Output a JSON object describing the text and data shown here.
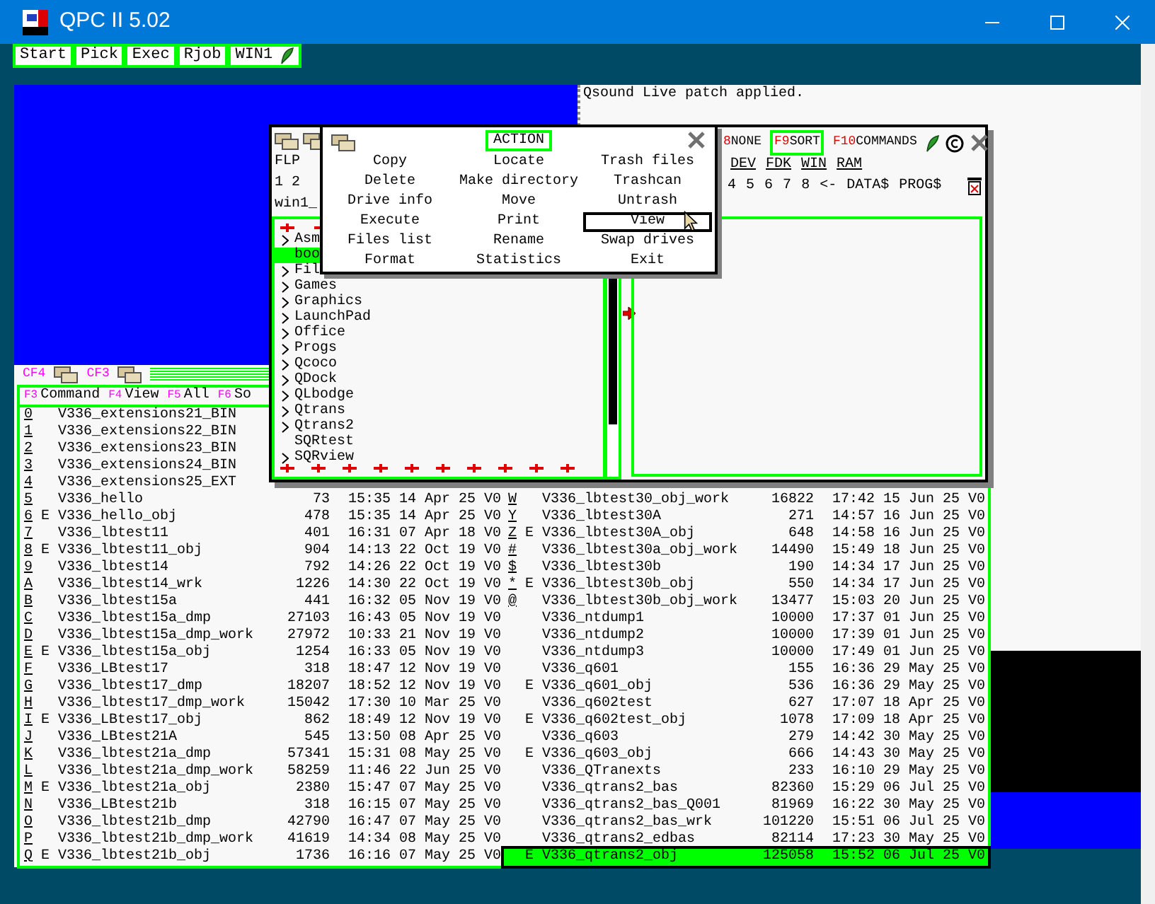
{
  "window": {
    "title": "QPC II 5.02"
  },
  "button_bar": [
    {
      "label": "Start",
      "kind": "command"
    },
    {
      "label": "Pick",
      "kind": "command"
    },
    {
      "label": "Exec",
      "kind": "command"
    },
    {
      "label": "Rjob",
      "kind": "command"
    },
    {
      "label": "WIN1",
      "kind": "window"
    }
  ],
  "sound_window": {
    "message": "Qsound Live patch applied."
  },
  "files_window": {
    "left_header": [
      "FLP",
      "1 2",
      "win1_"
    ],
    "function_keys": [
      {
        "key": "8",
        "label": "NONE",
        "selected": false
      },
      {
        "key": "F9",
        "label": "SORT",
        "selected": true
      },
      {
        "key": "F10",
        "label": "COMMANDS",
        "selected": false
      }
    ],
    "devices": [
      "DEV",
      "FDK",
      "WIN",
      "RAM"
    ],
    "shortcuts": [
      "4",
      "5",
      "6",
      "7",
      "8",
      "<-",
      "DATA$",
      "PROG$"
    ],
    "tree": [
      {
        "label": "Asm",
        "expandable": true,
        "selected": false
      },
      {
        "label": "boo",
        "expandable": false,
        "selected": true
      },
      {
        "label": "Fil",
        "expandable": true,
        "selected": false
      },
      {
        "label": "Games",
        "expandable": true,
        "selected": false
      },
      {
        "label": "Graphics",
        "expandable": true,
        "selected": false
      },
      {
        "label": "LaunchPad",
        "expandable": true,
        "selected": false
      },
      {
        "label": "Office",
        "expandable": true,
        "selected": false
      },
      {
        "label": "Progs",
        "expandable": true,
        "selected": false
      },
      {
        "label": "Qcoco",
        "expandable": true,
        "selected": false
      },
      {
        "label": "QDock",
        "expandable": true,
        "selected": false
      },
      {
        "label": "QLbodge",
        "expandable": true,
        "selected": false
      },
      {
        "label": "Qtrans",
        "expandable": true,
        "selected": false
      },
      {
        "label": "Qtrans2",
        "expandable": true,
        "selected": false
      },
      {
        "label": "SQRtest",
        "expandable": false,
        "selected": false
      },
      {
        "label": "SQRview",
        "expandable": true,
        "selected": false
      }
    ]
  },
  "action_menu": {
    "title": "ACTION",
    "items": [
      {
        "label": "Copy",
        "selected": false
      },
      {
        "label": "Locate",
        "selected": false
      },
      {
        "label": "Trash files",
        "selected": false
      },
      {
        "label": "Delete",
        "selected": false
      },
      {
        "label": "Make directory",
        "selected": false
      },
      {
        "label": "Trashcan",
        "selected": false
      },
      {
        "label": "Drive info",
        "selected": false
      },
      {
        "label": "Move",
        "selected": false
      },
      {
        "label": "Untrash",
        "selected": false
      },
      {
        "label": "Execute",
        "selected": false
      },
      {
        "label": "Print",
        "selected": false
      },
      {
        "label": "View",
        "selected": true
      },
      {
        "label": "Files list",
        "selected": false
      },
      {
        "label": "Rename",
        "selected": false
      },
      {
        "label": "Swap drives",
        "selected": false
      },
      {
        "label": "Format",
        "selected": false
      },
      {
        "label": "Statistics",
        "selected": false
      },
      {
        "label": "Exit",
        "selected": false
      }
    ]
  },
  "file_list": {
    "header_keys": [
      "CF4",
      "CF3"
    ],
    "function_keys": [
      {
        "key": "F3",
        "label": "Command"
      },
      {
        "key": "F4",
        "label": "View"
      },
      {
        "key": "F5",
        "label": "All"
      },
      {
        "key": "F6",
        "label": "So"
      }
    ],
    "left_column": [
      {
        "key": "0",
        "name": "V336_extensions21_BIN",
        "selected": false
      },
      {
        "key": "1",
        "name": "V336_extensions22_BIN",
        "selected": false
      },
      {
        "key": "2",
        "name": "V336_extensions23_BIN",
        "selected": false
      },
      {
        "key": "3",
        "name": "V336_extensions24_BIN",
        "selected": false
      },
      {
        "key": "4",
        "name": "V336_extensions25_EXT",
        "selected": false
      },
      {
        "key": "5",
        "name": "V336_hello",
        "size": "73",
        "time": "15:35",
        "date": "14 Apr 25",
        "version": "V0",
        "selected": false
      },
      {
        "key": "6",
        "flag": "E",
        "name": "V336_hello_obj",
        "size": "478",
        "time": "15:35",
        "date": "14 Apr 25",
        "version": "V0",
        "selected": false
      },
      {
        "key": "7",
        "name": "V336_lbtest11",
        "size": "401",
        "time": "16:31",
        "date": "07 Apr 18",
        "version": "V0",
        "selected": false
      },
      {
        "key": "8",
        "flag": "E",
        "name": "V336_lbtest11_obj",
        "size": "904",
        "time": "14:13",
        "date": "22 Oct 19",
        "version": "V0",
        "selected": false
      },
      {
        "key": "9",
        "name": "V336_lbtest14",
        "size": "792",
        "time": "14:26",
        "date": "22 Oct 19",
        "version": "V0",
        "selected": false
      },
      {
        "key": "A",
        "name": "V336_lbtest14_wrk",
        "size": "1226",
        "time": "14:30",
        "date": "22 Oct 19",
        "version": "V0",
        "selected": false
      },
      {
        "key": "B",
        "name": "V336_lbtest15a",
        "size": "441",
        "time": "16:32",
        "date": "05 Nov 19",
        "version": "V0",
        "selected": false
      },
      {
        "key": "C",
        "name": "V336_lbtest15a_dmp",
        "size": "27103",
        "time": "16:43",
        "date": "05 Nov 19",
        "version": "V0",
        "selected": false
      },
      {
        "key": "D",
        "name": "V336_lbtest15a_dmp_work",
        "size": "27972",
        "time": "10:33",
        "date": "21 Nov 19",
        "version": "V0",
        "selected": false
      },
      {
        "key": "E",
        "flag": "E",
        "name": "V336_lbtest15a_obj",
        "size": "1254",
        "time": "16:33",
        "date": "05 Nov 19",
        "version": "V0",
        "selected": false
      },
      {
        "key": "F",
        "name": "V336_LBtest17",
        "size": "318",
        "time": "18:47",
        "date": "12 Nov 19",
        "version": "V0",
        "selected": false
      },
      {
        "key": "G",
        "name": "V336_lbtest17_dmp",
        "size": "18207",
        "time": "18:52",
        "date": "12 Nov 19",
        "version": "V0",
        "selected": false
      },
      {
        "key": "H",
        "name": "V336_lbtest17_dmp_work",
        "size": "15042",
        "time": "17:30",
        "date": "10 Mar 25",
        "version": "V0",
        "selected": false
      },
      {
        "key": "I",
        "flag": "E",
        "name": "V336_LBtest17_obj",
        "size": "862",
        "time": "18:49",
        "date": "12 Nov 19",
        "version": "V0",
        "selected": false
      },
      {
        "key": "J",
        "name": "V336_LBtest21A",
        "size": "545",
        "time": "13:50",
        "date": "08 Apr 25",
        "version": "V0",
        "selected": false
      },
      {
        "key": "K",
        "name": "V336_lbtest21a_dmp",
        "size": "57341",
        "time": "15:31",
        "date": "08 May 25",
        "version": "V0",
        "selected": false
      },
      {
        "key": "L",
        "name": "V336_lbtest21a_dmp_work",
        "size": "58259",
        "time": "11:46",
        "date": "22 Jun 25",
        "version": "V0",
        "selected": false
      },
      {
        "key": "M",
        "flag": "E",
        "name": "V336_lbtest21a_obj",
        "size": "2380",
        "time": "15:47",
        "date": "07 May 25",
        "version": "V0",
        "selected": false
      },
      {
        "key": "N",
        "name": "V336_LBtest21b",
        "size": "318",
        "time": "16:15",
        "date": "07 May 25",
        "version": "V0",
        "selected": false
      },
      {
        "key": "O",
        "name": "V336_lbtest21b_dmp",
        "size": "42790",
        "time": "16:47",
        "date": "07 May 25",
        "version": "V0",
        "selected": false
      },
      {
        "key": "P",
        "name": "V336_lbtest21b_dmp_work",
        "size": "41619",
        "time": "14:34",
        "date": "08 May 25",
        "version": "V0",
        "selected": false
      },
      {
        "key": "Q",
        "flag": "E",
        "name": "V336_lbtest21b_obj",
        "size": "1736",
        "time": "16:16",
        "date": "07 May 25",
        "version": "V0",
        "selected": false
      }
    ],
    "right_column": [
      {
        "key": "W",
        "name": "V336_lbtest30_obj_work",
        "size": "16822",
        "time": "17:42",
        "date": "15 Jun 25",
        "version": "V0",
        "selected": false
      },
      {
        "key": "Y",
        "name": "V336_lbtest30A",
        "size": "271",
        "time": "14:57",
        "date": "16 Jun 25",
        "version": "V0",
        "selected": false
      },
      {
        "key": "Z",
        "flag": "E",
        "name": "V336_lbtest30A_obj",
        "size": "648",
        "time": "14:58",
        "date": "16 Jun 25",
        "version": "V0",
        "selected": false
      },
      {
        "key": "#",
        "name": "V336_lbtest30a_obj_work",
        "size": "14490",
        "time": "15:49",
        "date": "18 Jun 25",
        "version": "V0",
        "selected": false
      },
      {
        "key": "$",
        "name": "V336_lbtest30b",
        "size": "190",
        "time": "14:34",
        "date": "17 Jun 25",
        "version": "V0",
        "selected": false
      },
      {
        "key": "*",
        "flag": "E",
        "name": "V336_lbtest30b_obj",
        "size": "550",
        "time": "14:34",
        "date": "17 Jun 25",
        "version": "V0",
        "selected": false
      },
      {
        "key": "@",
        "name": "V336_lbtest30b_obj_work",
        "size": "13477",
        "time": "15:03",
        "date": "20 Jun 25",
        "version": "V0",
        "selected": false
      },
      {
        "name": "V336_ntdump1",
        "size": "10000",
        "time": "17:37",
        "date": "01 Jun 25",
        "version": "V0",
        "selected": false
      },
      {
        "name": "V336_ntdump2",
        "size": "10000",
        "time": "17:39",
        "date": "01 Jun 25",
        "version": "V0",
        "selected": false
      },
      {
        "name": "V336_ntdump3",
        "size": "10000",
        "time": "17:49",
        "date": "01 Jun 25",
        "version": "V0",
        "selected": false
      },
      {
        "name": "V336_q601",
        "size": "155",
        "time": "16:36",
        "date": "29 May 25",
        "version": "V0",
        "selected": false
      },
      {
        "flag": "E",
        "name": "V336_q601_obj",
        "size": "536",
        "time": "16:36",
        "date": "29 May 25",
        "version": "V0",
        "selected": false
      },
      {
        "name": "V336_q602test",
        "size": "627",
        "time": "17:07",
        "date": "18 Apr 25",
        "version": "V0",
        "selected": false
      },
      {
        "flag": "E",
        "name": "V336_q602test_obj",
        "size": "1078",
        "time": "17:09",
        "date": "18 Apr 25",
        "version": "V0",
        "selected": false
      },
      {
        "name": "V336_q603",
        "size": "279",
        "time": "14:42",
        "date": "30 May 25",
        "version": "V0",
        "selected": false
      },
      {
        "flag": "E",
        "name": "V336_q603_obj",
        "size": "666",
        "time": "14:43",
        "date": "30 May 25",
        "version": "V0",
        "selected": false
      },
      {
        "name": "V336_QTranexts",
        "size": "233",
        "time": "16:10",
        "date": "29 May 25",
        "version": "V0",
        "selected": false
      },
      {
        "name": "V336_qtrans2_bas",
        "size": "82360",
        "time": "15:29",
        "date": "06 Jul 25",
        "version": "V0",
        "selected": false
      },
      {
        "name": "V336_qtrans2_bas_Q001",
        "size": "81969",
        "time": "16:22",
        "date": "30 May 25",
        "version": "V0",
        "selected": false
      },
      {
        "name": "V336_qtrans2_bas_wrk",
        "size": "101220",
        "time": "15:51",
        "date": "06 Jul 25",
        "version": "V0",
        "selected": false
      },
      {
        "name": "V336_qtrans2_edbas",
        "size": "82114",
        "time": "17:23",
        "date": "30 May 25",
        "version": "V0",
        "selected": false
      },
      {
        "flag": "E",
        "name": "V336_qtrans2_obj",
        "size": "125058",
        "time": "15:52",
        "date": "06 Jul 25",
        "version": "V0",
        "selected": true
      }
    ]
  }
}
